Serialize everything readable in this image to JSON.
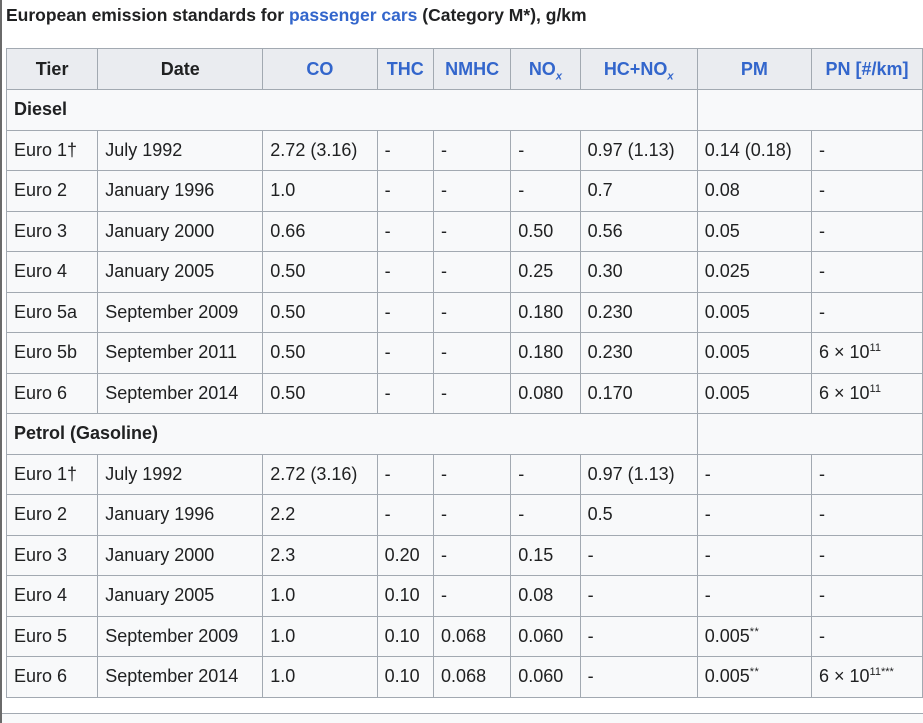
{
  "caption": {
    "prefix": "European emission standards for ",
    "link": "passenger cars",
    "suffix": " (Category M*), g/km"
  },
  "columns": {
    "tier": "Tier",
    "date": "Date",
    "co": "CO",
    "thc": "THC",
    "nmhc": "NMHC",
    "nox_base": "NO",
    "nox_sub": "x",
    "hcnox_base": "HC+NO",
    "hcnox_sub": "x",
    "pm": "PM",
    "pn": "PN [#/km]"
  },
  "groups": {
    "diesel": "Diesel",
    "petrol": "Petrol (Gasoline)"
  },
  "pn_value": {
    "base": "6 × 10",
    "exp": "11",
    "stars": "***"
  },
  "diesel_rows": [
    {
      "tier": "Euro 1†",
      "date": "July 1992",
      "co": "2.72 (3.16)",
      "thc": "-",
      "nmhc": "-",
      "nox": "-",
      "hcnox": "0.97 (1.13)",
      "pm": "0.14 (0.18)",
      "pn": "-"
    },
    {
      "tier": "Euro 2",
      "date": "January 1996",
      "co": "1.0",
      "thc": "-",
      "nmhc": "-",
      "nox": "-",
      "hcnox": "0.7",
      "pm": "0.08",
      "pn": "-"
    },
    {
      "tier": "Euro 3",
      "date": "January 2000",
      "co": "0.66",
      "thc": "-",
      "nmhc": "-",
      "nox": "0.50",
      "hcnox": "0.56",
      "pm": "0.05",
      "pn": "-"
    },
    {
      "tier": "Euro 4",
      "date": "January 2005",
      "co": "0.50",
      "thc": "-",
      "nmhc": "-",
      "nox": "0.25",
      "hcnox": "0.30",
      "pm": "0.025",
      "pn": "-"
    },
    {
      "tier": "Euro 5a",
      "date": "September 2009",
      "co": "0.50",
      "thc": "-",
      "nmhc": "-",
      "nox": "0.180",
      "hcnox": "0.230",
      "pm": "0.005",
      "pn": "-"
    },
    {
      "tier": "Euro 5b",
      "date": "September 2011",
      "co": "0.50",
      "thc": "-",
      "nmhc": "-",
      "nox": "0.180",
      "hcnox": "0.230",
      "pm": "0.005",
      "pn": "6 × 10^11"
    },
    {
      "tier": "Euro 6",
      "date": "September 2014",
      "co": "0.50",
      "thc": "-",
      "nmhc": "-",
      "nox": "0.080",
      "hcnox": "0.170",
      "pm": "0.005",
      "pn": "6 × 10^11"
    }
  ],
  "petrol_rows": [
    {
      "tier": "Euro 1†",
      "date": "July 1992",
      "co": "2.72 (3.16)",
      "thc": "-",
      "nmhc": "-",
      "nox": "-",
      "hcnox": "0.97 (1.13)",
      "pm": "-",
      "pn": "-"
    },
    {
      "tier": "Euro 2",
      "date": "January 1996",
      "co": "2.2",
      "thc": "-",
      "nmhc": "-",
      "nox": "-",
      "hcnox": "0.5",
      "pm": "-",
      "pn": "-"
    },
    {
      "tier": "Euro 3",
      "date": "January 2000",
      "co": "2.3",
      "thc": "0.20",
      "nmhc": "-",
      "nox": "0.15",
      "hcnox": "-",
      "pm": "-",
      "pn": "-"
    },
    {
      "tier": "Euro 4",
      "date": "January 2005",
      "co": "1.0",
      "thc": "0.10",
      "nmhc": "-",
      "nox": "0.08",
      "hcnox": "-",
      "pm": "-",
      "pn": "-"
    },
    {
      "tier": "Euro 5",
      "date": "September 2009",
      "co": "1.0",
      "thc": "0.10",
      "nmhc": "0.068",
      "nox": "0.060",
      "hcnox": "-",
      "pm": "0.005**",
      "pn": "-"
    },
    {
      "tier": "Euro 6",
      "date": "September 2014",
      "co": "1.0",
      "thc": "0.10",
      "nmhc": "0.068",
      "nox": "0.060",
      "hcnox": "-",
      "pm": "0.005**",
      "pn": "6 × 10^11***"
    }
  ],
  "colors": {
    "link": "#3366cc",
    "text": "#202122",
    "border": "#a2a9b1",
    "header_bg": "#eaecf0",
    "cell_bg": "#f8f9fa"
  }
}
